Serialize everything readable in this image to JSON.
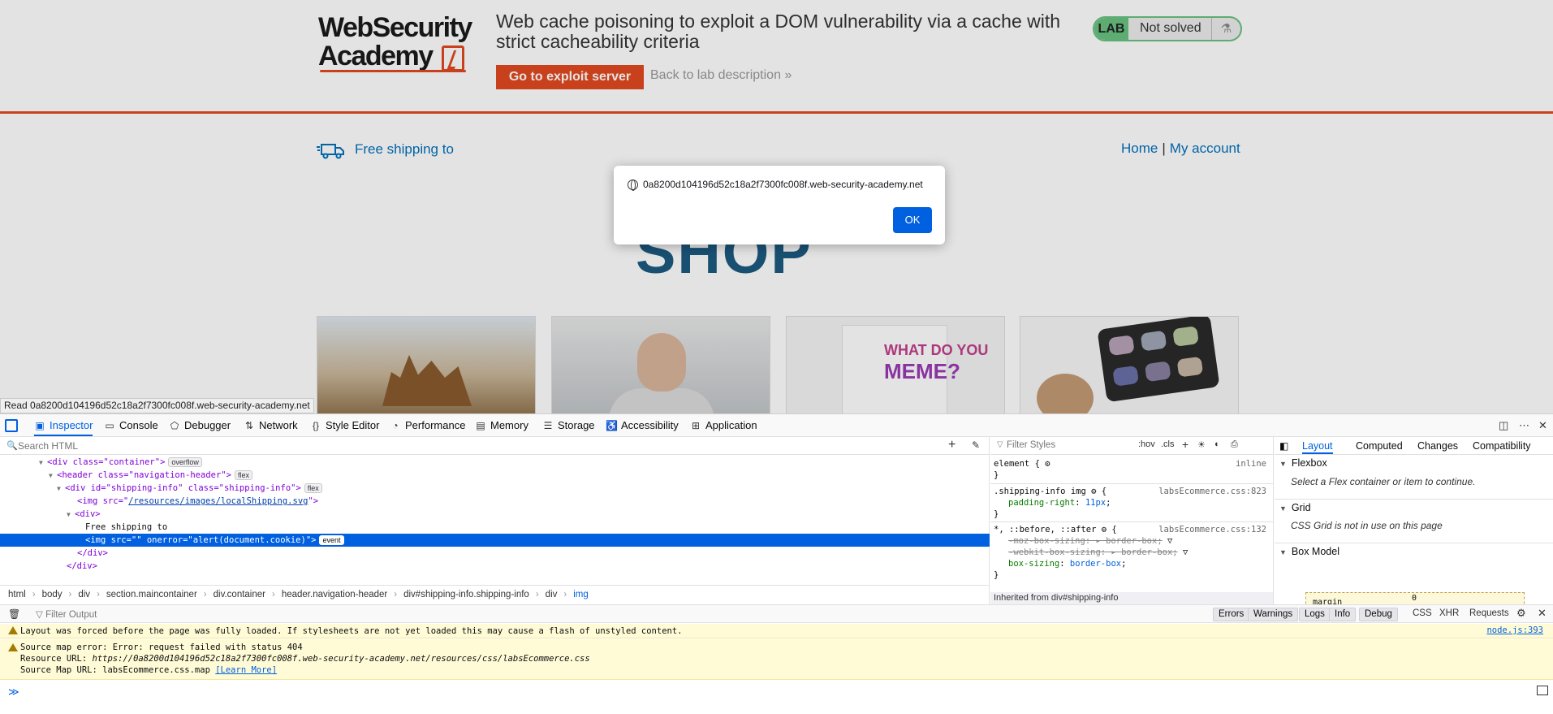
{
  "lab": {
    "logo_line1": "WebSecurity",
    "logo_line2": "Academy",
    "title": "Web cache poisoning to exploit a DOM vulnerability via a cache with strict cacheability criteria",
    "exploit_button": "Go to exploit server",
    "back_link": "Back to lab description",
    "back_chevron": "»",
    "status_badge": "LAB",
    "status_text": "Not solved",
    "flask_icon": "flask-icon"
  },
  "shop": {
    "shipping_text": "Free shipping to",
    "nav_home": "Home",
    "nav_separator": "|",
    "nav_account": "My account",
    "shop_word": "SHOP",
    "meme_line1": "WHAT DO YOU",
    "meme_line2": "MEME?"
  },
  "status_tooltip": "Read 0a8200d104196d52c18a2f7300fc008f.web-security-academy.net",
  "alert_dialog": {
    "host": "0a8200d104196d52c18a2f7300fc008f.web-security-academy.net",
    "ok_label": "OK"
  },
  "devtools": {
    "tabs": [
      {
        "label": "Inspector",
        "icon": "inspector-icon"
      },
      {
        "label": "Console",
        "icon": "console-icon"
      },
      {
        "label": "Debugger",
        "icon": "debugger-icon"
      },
      {
        "label": "Network",
        "icon": "network-icon"
      },
      {
        "label": "Style Editor",
        "icon": "style-editor-icon"
      },
      {
        "label": "Performance",
        "icon": "performance-icon"
      },
      {
        "label": "Memory",
        "icon": "memory-icon"
      },
      {
        "label": "Storage",
        "icon": "storage-icon"
      },
      {
        "label": "Accessibility",
        "icon": "accessibility-icon"
      },
      {
        "label": "Application",
        "icon": "application-icon"
      }
    ],
    "search_html_placeholder": "Search HTML",
    "tree": {
      "container_open": "<div class=\"container\">",
      "container_badge": "overflow",
      "header_open": "<header class=\"navigation-header\">",
      "header_badge": "flex",
      "shipinfo_open": "<div id=\"shipping-info\" class=\"shipping-info\">",
      "shipinfo_badge": "flex",
      "img_prefix": "<img src=\"",
      "img_src": "/resources/images/localShipping.svg",
      "img_suffix": "\">",
      "div_open": "<div>",
      "text_node": "Free shipping to",
      "selected_line": "<img src=\"\" onerror=\"alert(document.cookie)\">",
      "selected_badge": "event",
      "div_close": "</div>",
      "div_close2": "</div>"
    },
    "breadcrumbs": [
      "html",
      "body",
      "div",
      "section.maincontainer",
      "div.container",
      "header.navigation-header",
      "div#shipping-info.shipping-info",
      "div",
      "img"
    ],
    "styles": {
      "filter_placeholder": "Filter Styles",
      "hov": ":hov",
      "cls": ".cls",
      "element_selector": "element {",
      "element_source": "inline",
      "close_brace": "}",
      "rule1_selector": ".shipping-info img",
      "rule1_source": "labsEcommerce.css:823",
      "rule1_prop": "padding-right",
      "rule1_val": "11px",
      "rule2_selector": "*, ::before, ::after",
      "rule2_source": "labsEcommerce.css:132",
      "rule2_p1": "-moz-box-sizing: ▸ border-box;",
      "rule2_p2": "-webkit-box-sizing: ▸ border-box;",
      "rule2_p3_prop": "box-sizing",
      "rule2_p3_val": "border-box",
      "inherited": "Inherited from div#shipping-info"
    },
    "layout": {
      "tabs": [
        "Layout",
        "Computed",
        "Changes",
        "Compatibility"
      ],
      "flexbox_header": "Flexbox",
      "flexbox_msg": "Select a Flex container or item to continue.",
      "grid_header": "Grid",
      "grid_msg": "CSS Grid is not in use on this page",
      "boxmodel_header": "Box Model",
      "margin_label": "margin",
      "margin_value": "0"
    },
    "console": {
      "filter_placeholder": "Filter Output",
      "levels": [
        "Errors",
        "Warnings",
        "Logs",
        "Info",
        "Debug"
      ],
      "categories": [
        "CSS",
        "XHR",
        "Requests"
      ],
      "warning1": "Layout was forced before the page was fully loaded. If stylesheets are not yet loaded this may cause a flash of unstyled content.",
      "warning1_location": "node.js:393",
      "warning2_line1": "Source map error: Error: request failed with status 404",
      "warning2_line2_label": "Resource URL: ",
      "warning2_line2_url": "https://0a8200d104196d52c18a2f7300fc008f.web-security-academy.net/resources/css/labsEcommerce.css",
      "warning2_line3_label": "Source Map URL: labsEcommerce.css.map ",
      "warning2_learn_more": "[Learn More]",
      "prompt_chevron": "≫"
    }
  }
}
